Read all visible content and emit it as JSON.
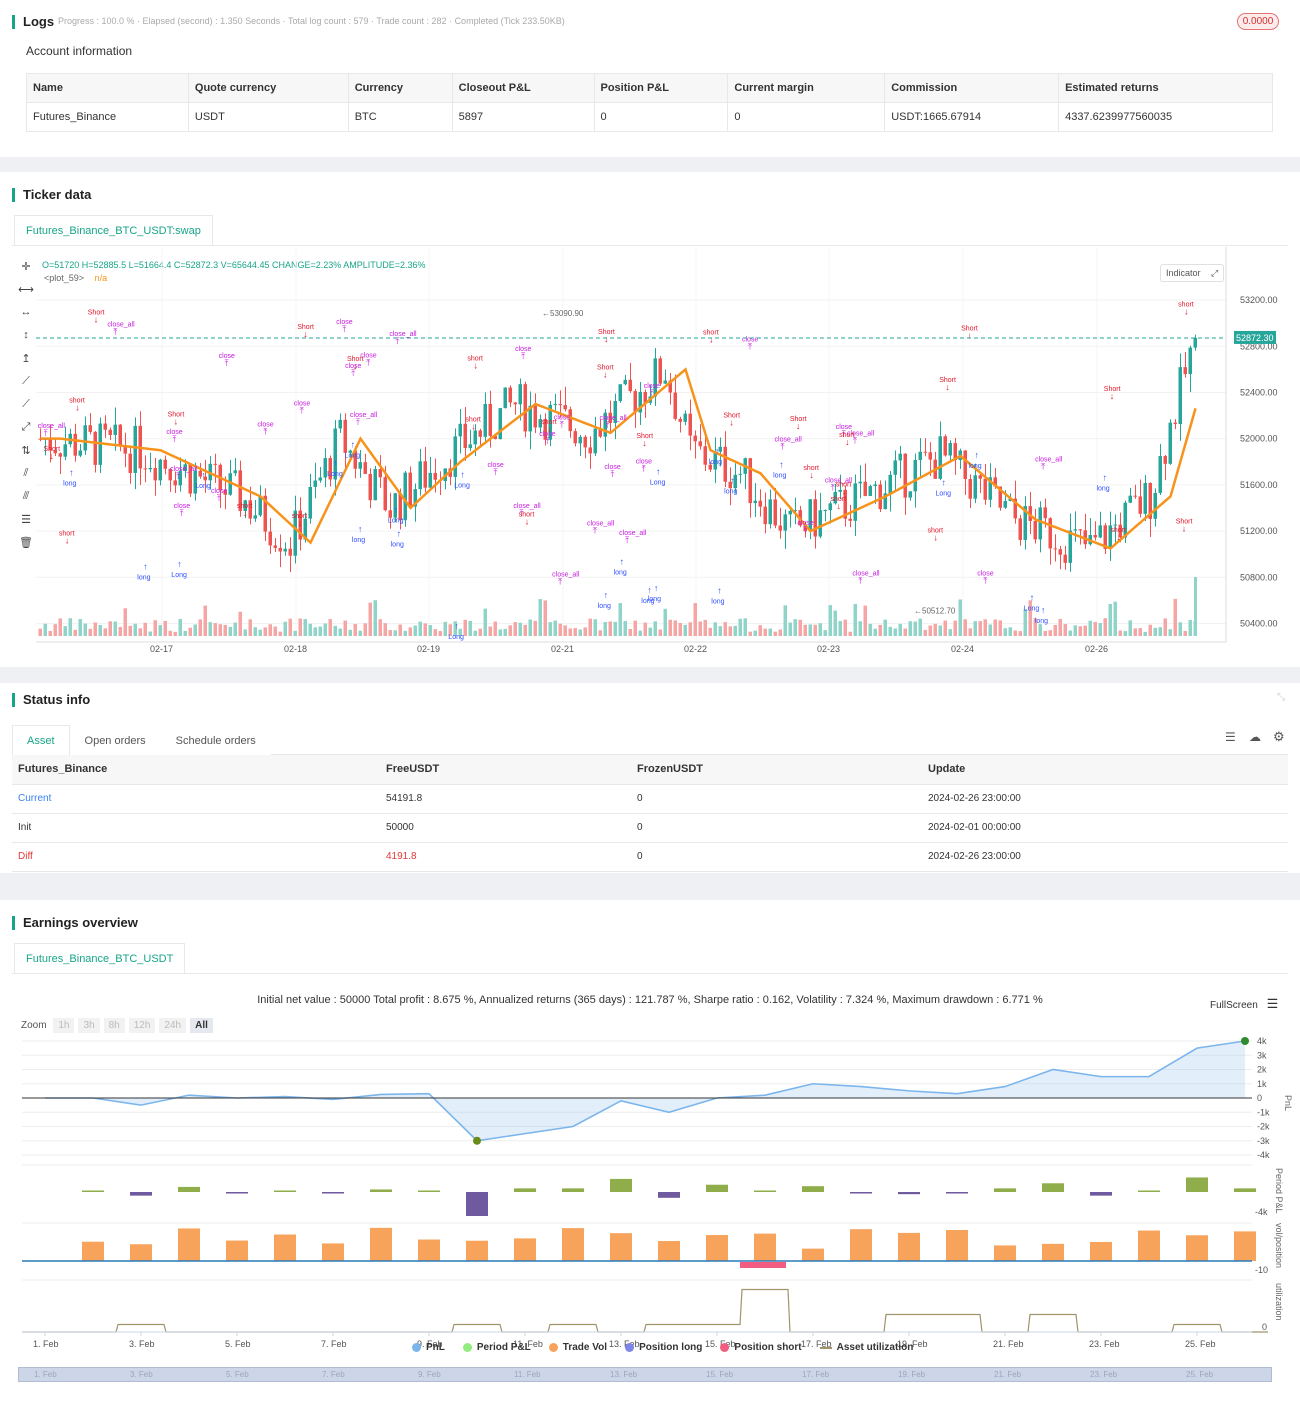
{
  "logs": {
    "title": "Logs",
    "summary": "Progress : 100.0 % · Elapsed (second) : 1.350  Seconds · Total log count : 579 · Trade count : 282 · Completed (Tick 233.50KB)",
    "badge": "0.0000"
  },
  "account": {
    "title": "Account information",
    "columns": [
      "Name",
      "Quote currency",
      "Currency",
      "Closeout P&L",
      "Position P&L",
      "Current margin",
      "Commission",
      "Estimated returns"
    ],
    "row": [
      "Futures_Binance",
      "USDT",
      "BTC",
      "5897",
      "0",
      "0",
      "USDT:1665.67914",
      "4337.6239977560035"
    ]
  },
  "ticker": {
    "title": "Ticker data",
    "tab": "Futures_Binance_BTC_USDT:swap",
    "ohlc": "O=51720 H=52885.5 L=51664.4 C=52872.3 V=65644.45 CHANGE=2.23% AMPLITUDE=2.36%",
    "plot_label": "<plot_59>",
    "plot_value": "n/a",
    "indicator_btn": "Indicator",
    "last_price": "52872.30",
    "high_label": "53090.90",
    "low_label": "50512.70",
    "y_ticks": [
      "53200.00",
      "52800.00",
      "52400.00",
      "52000.00",
      "51600.00",
      "51200.00",
      "50800.00",
      "50400.00"
    ],
    "x_ticks": [
      "02-17",
      "02-18",
      "02-19",
      "02-21",
      "02-22",
      "02-23",
      "02-24",
      "02-26"
    ],
    "tools": [
      "crosshair-icon",
      "horizontal-line-icon",
      "horizontal-ray-icon",
      "vertical-line-icon",
      "vertical-ray-icon",
      "trend-line-icon",
      "ray-icon",
      "extended-line-icon",
      "price-range-icon",
      "parallel-channel-icon",
      "fib-icon",
      "settings-lines-icon",
      "trash-icon"
    ]
  },
  "status": {
    "title": "Status info",
    "tabs": [
      "Asset",
      "Open orders",
      "Schedule orders"
    ],
    "columns": [
      "Futures_Binance",
      "FreeUSDT",
      "FrozenUSDT",
      "Update"
    ],
    "rows": [
      [
        "Current",
        "54191.8",
        "0",
        "2024-02-26 23:00:00"
      ],
      [
        "Init",
        "50000",
        "0",
        "2024-02-01 00:00:00"
      ],
      [
        "Diff",
        "4191.8",
        "0",
        "2024-02-26 23:00:00"
      ]
    ]
  },
  "earnings": {
    "title": "Earnings overview",
    "tab": "Futures_Binance_BTC_USDT",
    "summary": "Initial net value : 50000 Total profit : 8.675 %, Annualized returns (365 days) : 121.787 %, Sharpe ratio : 0.162, Volatility : 7.324 %, Maximum drawdown : 6.771 %",
    "fullscreen": "FullScreen",
    "zoom_label": "Zoom",
    "zoom_buttons": [
      "1h",
      "3h",
      "8h",
      "12h",
      "24h",
      "All"
    ],
    "pnl_ticks": [
      "4k",
      "3k",
      "2k",
      "1k",
      "0",
      "-1k",
      "-2k",
      "-3k",
      "-4k"
    ],
    "period_ticks": [
      "-4k"
    ],
    "vol_ticks": [
      "-10"
    ],
    "util_ticks": [
      "0"
    ],
    "axis_titles": [
      "PnL",
      "Period P&L",
      "vol/position",
      "utilization"
    ],
    "x_ticks": [
      "1. Feb",
      "3. Feb",
      "5. Feb",
      "7. Feb",
      "9. Feb",
      "11. Feb",
      "13. Feb",
      "15. Feb",
      "17. Feb",
      "19. Feb",
      "21. Feb",
      "23. Feb",
      "25. Feb"
    ],
    "legend": [
      {
        "label": "PnL",
        "color": "#7cb5ec"
      },
      {
        "label": "Period P&L",
        "color": "#90ed7d"
      },
      {
        "label": "Trade Vol",
        "color": "#f7a35c"
      },
      {
        "label": "Position long",
        "color": "#8085e9"
      },
      {
        "label": "Position short",
        "color": "#f15c80"
      },
      {
        "label": "Asset utilization",
        "color": "#a0956a"
      }
    ]
  },
  "chart_data": {
    "type": "line",
    "x": [
      "1. Feb",
      "2. Feb",
      "3. Feb",
      "4. Feb",
      "5. Feb",
      "6. Feb",
      "7. Feb",
      "8. Feb",
      "9. Feb",
      "10. Feb",
      "11. Feb",
      "12. Feb",
      "13. Feb",
      "14. Feb",
      "15. Feb",
      "16. Feb",
      "17. Feb",
      "18. Feb",
      "19. Feb",
      "20. Feb",
      "21. Feb",
      "22. Feb",
      "23. Feb",
      "24. Feb",
      "25. Feb",
      "26. Feb"
    ],
    "series": [
      {
        "name": "PnL",
        "values": [
          0,
          0,
          -500,
          200,
          0,
          100,
          -100,
          250,
          300,
          -3000,
          -2500,
          -2000,
          -200,
          -1000,
          0,
          200,
          1000,
          800,
          500,
          300,
          800,
          2000,
          1500,
          1500,
          3500,
          4000
        ]
      }
    ],
    "ylim": [
      -4000,
      4000
    ],
    "ylabel": "PnL"
  }
}
